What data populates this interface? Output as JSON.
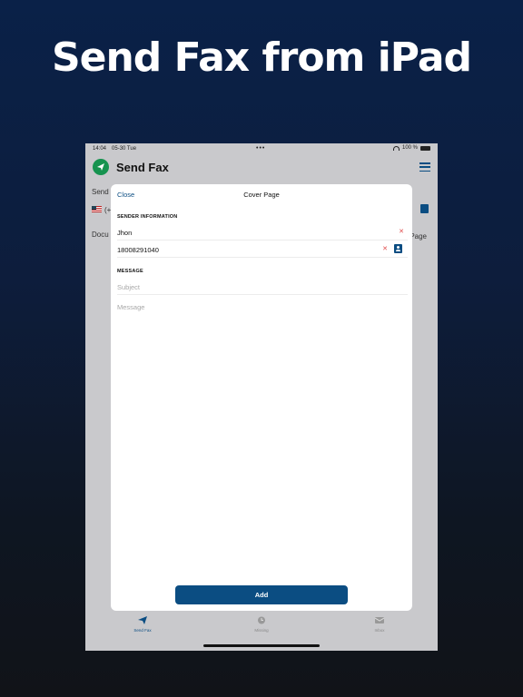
{
  "headline": "Send Fax from iPad",
  "status_bar": {
    "time": "14:04",
    "date": "05-30 Tue",
    "dots": "•••",
    "battery": "100 %"
  },
  "app_bar": {
    "title": "Send Fax"
  },
  "background": {
    "send_label": "Send",
    "country_code": "(+",
    "documents_label": "Docu",
    "page_label": "Page"
  },
  "modal": {
    "close_label": "Close",
    "title": "Cover Page",
    "sender_section": "SENDER INFORMATION",
    "sender_name": "Jhon",
    "sender_phone": "18008291040",
    "message_section": "MESSAGE",
    "subject_placeholder": "Subject",
    "message_placeholder": "Message",
    "add_label": "Add"
  },
  "tabs": [
    {
      "label": "Send Fax",
      "icon": "paper-plane-icon",
      "active": true
    },
    {
      "label": "Missing",
      "icon": "clock-icon",
      "active": false
    },
    {
      "label": "Inbox",
      "icon": "inbox-icon",
      "active": false
    }
  ],
  "colors": {
    "accent": "#0b4d82",
    "logo_green": "#16934f",
    "clear_red": "#e04a4a"
  }
}
